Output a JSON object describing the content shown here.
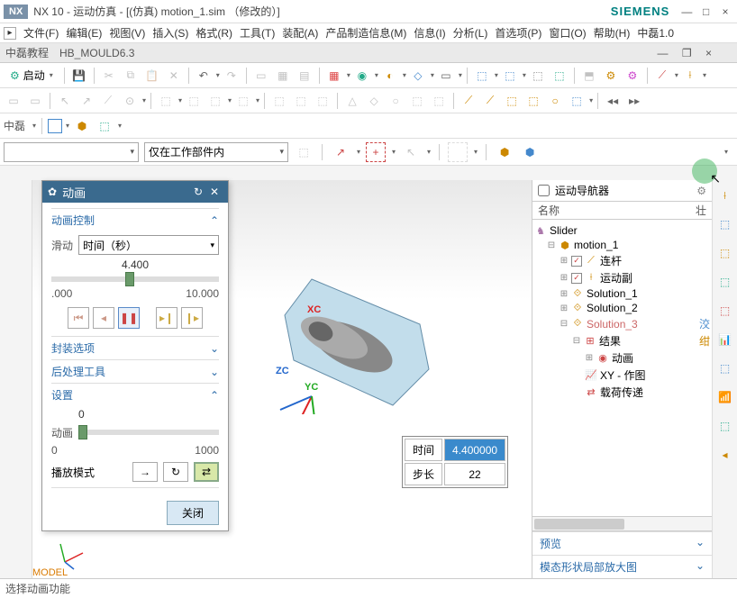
{
  "titlebar": {
    "app": "NX 10 - 运动仿真 - [(仿真) motion_1.sim （修改的）]",
    "brand": "SIEMENS"
  },
  "menu": {
    "items": [
      "文件(F)",
      "编辑(E)",
      "视图(V)",
      "插入(S)",
      "格式(R)",
      "工具(T)",
      "装配(A)",
      "产品制造信息(M)",
      "信息(I)",
      "分析(L)",
      "首选项(P)",
      "窗口(O)",
      "帮助(H)",
      "中磊1.0"
    ]
  },
  "tabs": {
    "t1": "中磊教程",
    "t2": "HB_MOULD6.3"
  },
  "start_label": "启动",
  "combo_worklabel": "仅在工作部件内",
  "row4_label": "中磊",
  "anim": {
    "title": "动画",
    "ctrl_title": "动画控制",
    "slide_label": "滑动",
    "time_unit": "时间（秒）",
    "value": "4.400",
    "min": ".000",
    "max": "10.000",
    "pack_title": "封装选项",
    "post_title": "后处理工具",
    "settings_title": "设置",
    "anim_label": "动画",
    "s_min": "0",
    "s_mid": "0",
    "s_max": "1000",
    "play_mode": "播放模式",
    "close": "关闭"
  },
  "info": {
    "time_label": "时间",
    "time_val": "4.400000",
    "step_label": "步长",
    "step_val": "22"
  },
  "nav": {
    "title": "运动导航器",
    "col_name": "名称",
    "col_r": "壮",
    "root": "Slider",
    "n1": "motion_1",
    "n2": "连杆",
    "n3": "运动副",
    "n4": "Solution_1",
    "n5": "Solution_2",
    "n6": "Solution_3",
    "n7": "结果",
    "n8": "动画",
    "n9": "XY - 作图",
    "n10": "载荷传递",
    "preview": "预览",
    "mode_shape": "模态形状局部放大图",
    "side_r": "洨",
    "side_r2": "绀"
  },
  "axis": {
    "xc": "XC",
    "yc": "YC",
    "zc": "ZC"
  },
  "viewport": {
    "label": "MODEL"
  },
  "status": "选择动画功能"
}
